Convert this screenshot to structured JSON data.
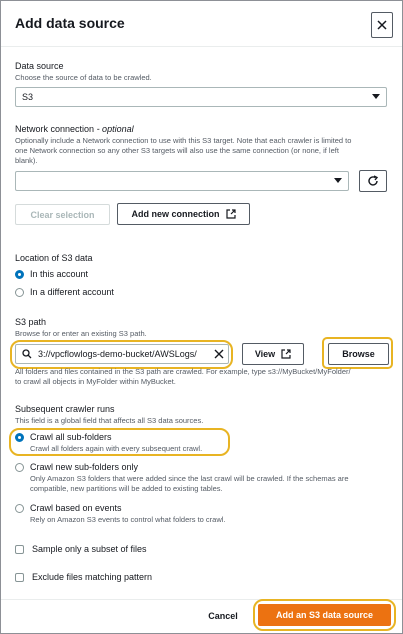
{
  "modal": {
    "title": "Add data source"
  },
  "data_source": {
    "label": "Data source",
    "description": "Choose the source of data to be crawled.",
    "value": "S3"
  },
  "network": {
    "label": "Network connection",
    "label_optional": "- optional",
    "description_line1": "Optionally include a Network connection to use with this S3 target. Note that each crawler is limited to",
    "description_line2": "one Network connection so any other S3 targets will also use the same connection (or none, if left",
    "description_line3": "blank).",
    "value": "",
    "clear_label": "Clear selection",
    "add_label": "Add new connection"
  },
  "location": {
    "label": "Location of S3 data",
    "options": [
      "In this account",
      "In a different account"
    ],
    "selected": "In this account"
  },
  "s3_path": {
    "label": "S3 path",
    "description": "Browse for or enter an existing S3 path.",
    "value": "3://vpcflowlogs-demo-bucket/AWSLogs/",
    "view_label": "View",
    "browse_label": "Browse",
    "hint_line1": "All folders and files contained in the S3 path are crawled. For example, type s3://MyBucket/MyFolder/",
    "hint_line2": "to crawl all objects in MyFolder within MyBucket."
  },
  "subsequent": {
    "label": "Subsequent crawler runs",
    "description": "This field is a global field that affects all S3 data sources.",
    "options": [
      {
        "label": "Crawl all sub-folders",
        "desc1": "Crawl all folders again with every subsequent crawl.",
        "desc2": ""
      },
      {
        "label": "Crawl new sub-folders only",
        "desc1": "Only Amazon S3 folders that were added since the last crawl will be crawled. If the schemas are",
        "desc2": "compatible, new partitions will be added to existing tables."
      },
      {
        "label": "Crawl based on events",
        "desc1": "Rely on Amazon S3 events to control what folders to crawl.",
        "desc2": ""
      }
    ],
    "selected": "Crawl all sub-folders"
  },
  "checkboxes": {
    "sample": "Sample only a subset of files",
    "exclude": "Exclude files matching pattern"
  },
  "footer": {
    "cancel_label": "Cancel",
    "submit_label": "Add an S3 data source"
  },
  "colors": {
    "primary": "#ec7211",
    "selected_radio": "#0073bb",
    "highlight": "#e8b423"
  }
}
